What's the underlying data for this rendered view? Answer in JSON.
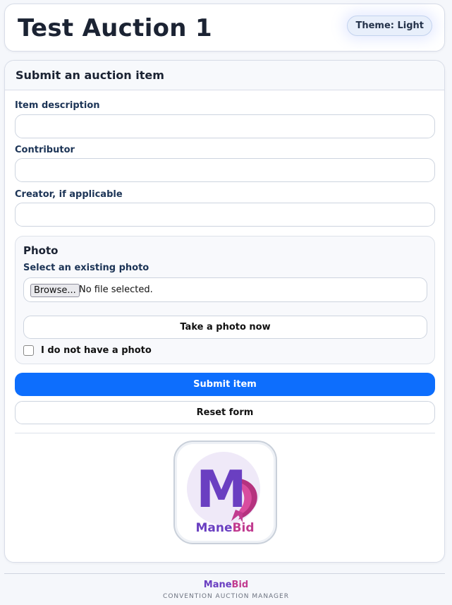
{
  "header": {
    "title": "Test Auction 1",
    "theme_label": "Theme: Light"
  },
  "form": {
    "heading": "Submit an auction item",
    "item_description_label": "Item description",
    "item_description_value": "",
    "contributor_label": "Contributor",
    "contributor_value": "",
    "creator_label": "Creator, if applicable",
    "creator_value": "",
    "photo": {
      "heading": "Photo",
      "select_label": "Select an existing photo",
      "browse_label": "Browse...",
      "file_status": "No file selected.",
      "take_photo_label": "Take a photo now",
      "no_photo_label": "I do not have a photo",
      "no_photo_checked": false
    },
    "submit_label": "Submit item",
    "reset_label": "Reset form"
  },
  "logo": {
    "letter": "M",
    "wordmark_part1": "Mane",
    "wordmark_part2": "Bid"
  },
  "footer": {
    "brand_part1": "Mane",
    "brand_part2": "Bid",
    "tagline": "CONVENTION AUCTION MANAGER"
  },
  "colors": {
    "primary": "#0d6efd",
    "brand_purple": "#6a3fc1",
    "brand_pink": "#c13b8f"
  }
}
